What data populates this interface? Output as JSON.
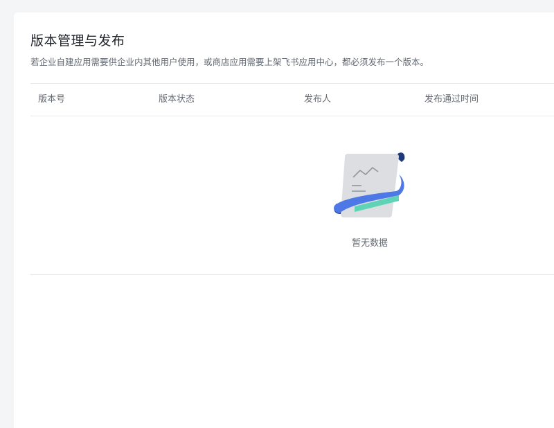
{
  "page": {
    "title": "版本管理与发布",
    "description": "若企业自建应用需要供企业内其他用户使用，或商店应用需要上架飞书应用中心，都必须发布一个版本。"
  },
  "table": {
    "columns": [
      "版本号",
      "版本状态",
      "发布人",
      "发布通过时间"
    ],
    "empty_text": "暂无数据"
  },
  "icons": {
    "empty": "empty-document-icon"
  },
  "colors": {
    "background": "#f4f5f7",
    "card": "#ffffff",
    "text_primary": "#1f2329",
    "text_secondary": "#646a73",
    "divider": "#e8e9eb",
    "accent_blue": "#4e78e6",
    "accent_green": "#5fd3b5",
    "accent_navy": "#1f3a7a"
  }
}
